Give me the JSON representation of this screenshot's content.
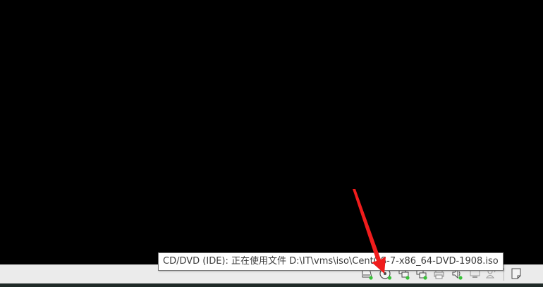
{
  "tooltip": {
    "text": "CD/DVD (IDE): 正在使用文件 D:\\IT\\vms\\iso\\CentOS-7-x86_64-DVD-1908.iso"
  },
  "statusbar": {
    "devices": [
      {
        "icon": "hard-disk-icon",
        "active": true
      },
      {
        "icon": "cd-dvd-icon",
        "active": true
      },
      {
        "icon": "network-adapter-icon",
        "active": true
      },
      {
        "icon": "usb-controller-icon",
        "active": true
      },
      {
        "icon": "printer-icon",
        "active": false
      },
      {
        "icon": "sound-card-icon",
        "active": true
      },
      {
        "icon": "display-icon",
        "active": false
      },
      {
        "icon": "user-share-icon",
        "active": false
      },
      {
        "icon": "message-log-icon",
        "active": false
      }
    ]
  },
  "colors": {
    "screen": "#000000",
    "statusbar": "#ebebeb",
    "active_led": "#38c038",
    "annotation_arrow": "#f01c1c",
    "tooltip_border": "#767676"
  }
}
